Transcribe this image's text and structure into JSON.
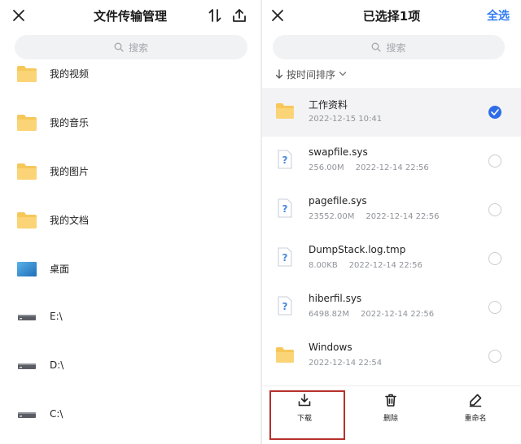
{
  "left": {
    "title": "文件传输管理",
    "search_placeholder": "搜索",
    "items": [
      {
        "label": "我的视频",
        "icon": "folder-icon"
      },
      {
        "label": "我的音乐",
        "icon": "folder-icon"
      },
      {
        "label": "我的图片",
        "icon": "folder-icon"
      },
      {
        "label": "我的文档",
        "icon": "folder-icon"
      },
      {
        "label": "桌面",
        "icon": "desktop-icon"
      },
      {
        "label": "E:\\",
        "icon": "drive-icon"
      },
      {
        "label": "D:\\",
        "icon": "drive-icon"
      },
      {
        "label": "C:\\",
        "icon": "drive-icon"
      }
    ]
  },
  "right": {
    "title": "已选择1项",
    "select_all": "全选",
    "search_placeholder": "搜索",
    "sort_label": "按时间排序",
    "files": [
      {
        "name": "工作资料",
        "size": "",
        "date": "2022-12-15 10:41",
        "type": "folder",
        "selected": true
      },
      {
        "name": "swapfile.sys",
        "size": "256.00M",
        "date": "2022-12-14 22:56",
        "type": "file",
        "selected": false
      },
      {
        "name": "pagefile.sys",
        "size": "23552.00M",
        "date": "2022-12-14 22:56",
        "type": "file",
        "selected": false
      },
      {
        "name": "DumpStack.log.tmp",
        "size": "8.00KB",
        "date": "2022-12-14 22:56",
        "type": "file",
        "selected": false
      },
      {
        "name": "hiberfil.sys",
        "size": "6498.82M",
        "date": "2022-12-14 22:56",
        "type": "file",
        "selected": false
      },
      {
        "name": "Windows",
        "size": "",
        "date": "2022-12-14 22:54",
        "type": "folder",
        "selected": false
      }
    ],
    "actions": {
      "download": "下载",
      "delete": "删除",
      "rename": "重命名"
    }
  },
  "colors": {
    "accent": "#2f7cf6",
    "folder": "#f6c85a",
    "highlight": "#b7302b"
  }
}
